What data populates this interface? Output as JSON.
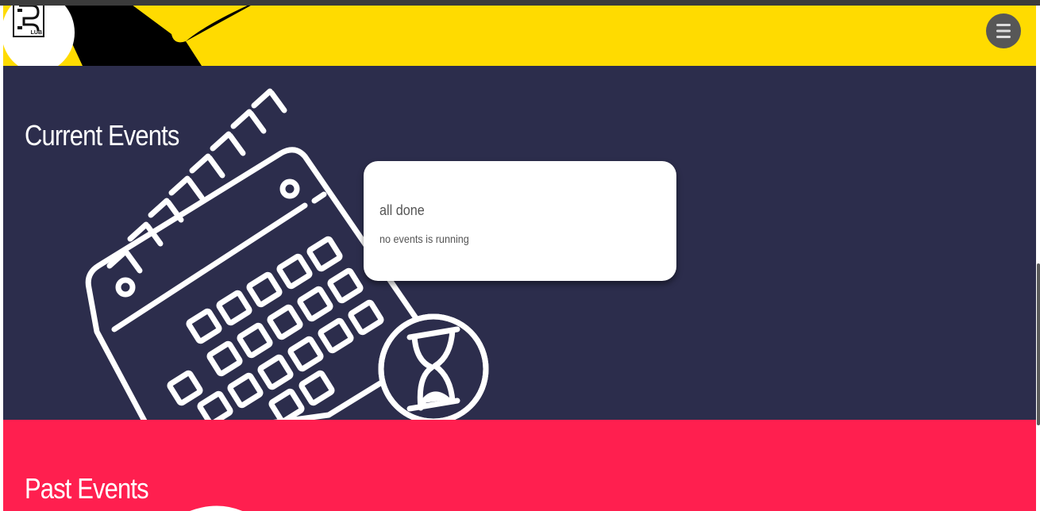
{
  "header": {
    "logo_text": "LUB",
    "menu_icon": "hamburger-menu-icon",
    "colors": {
      "background": "#ffdb00",
      "accent": "#000000"
    }
  },
  "current_events": {
    "heading": "Current Events",
    "illustration": "calendar-hourglass-icon",
    "card": {
      "title": "all done",
      "message": "no events is running"
    },
    "background": "#2c2d4c"
  },
  "past_events": {
    "heading": "Past Events",
    "background": "#ff1f4f"
  }
}
